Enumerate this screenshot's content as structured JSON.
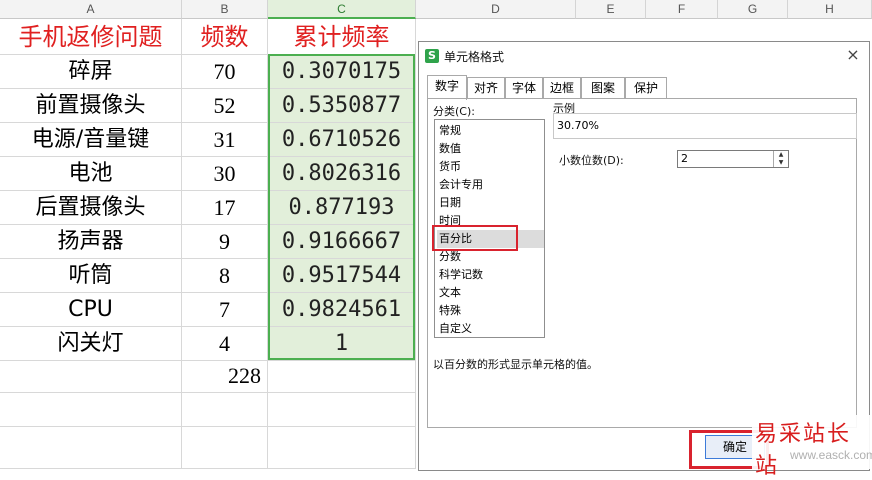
{
  "columns": [
    "A",
    "B",
    "C",
    "D",
    "E",
    "F",
    "G",
    "H"
  ],
  "headers": {
    "name": "手机返修问题",
    "count": "频数",
    "cum": "累计频率"
  },
  "rows": [
    {
      "name": "碎屏",
      "count": "70",
      "cum": "0.3070175"
    },
    {
      "name": "前置摄像头",
      "count": "52",
      "cum": "0.5350877"
    },
    {
      "name": "电源/音量键",
      "count": "31",
      "cum": "0.6710526"
    },
    {
      "name": "电池",
      "count": "30",
      "cum": "0.8026316"
    },
    {
      "name": "后置摄像头",
      "count": "17",
      "cum": "0.877193"
    },
    {
      "name": "扬声器",
      "count": "9",
      "cum": "0.9166667"
    },
    {
      "name": "听筒",
      "count": "8",
      "cum": "0.9517544"
    },
    {
      "name": "CPU",
      "count": "7",
      "cum": "0.9824561"
    },
    {
      "name": "闪关灯",
      "count": "4",
      "cum": "1"
    }
  ],
  "total": "228",
  "dialog": {
    "icon": "S",
    "title": "单元格格式",
    "close": "×",
    "tabs": [
      "数字",
      "对齐",
      "字体",
      "边框",
      "图案",
      "保护"
    ],
    "category_label": "分类(C):",
    "categories": [
      "常规",
      "数值",
      "货币",
      "会计专用",
      "日期",
      "时间",
      "百分比",
      "分数",
      "科学记数",
      "文本",
      "特殊",
      "自定义"
    ],
    "selected_category": "百分比",
    "sample_label": "示例",
    "sample_value": "30.70%",
    "decimals_label": "小数位数(D):",
    "decimals_value": "2",
    "description": "以百分数的形式显示单元格的值。",
    "ok": "确定"
  },
  "watermark": {
    "text": "易采站长站",
    "url": "www.easck.com"
  },
  "colors": {
    "header_red": "#e02020",
    "selection_green": "#4caf50",
    "fill_green": "#e2efda",
    "highlight_red": "#d9232e"
  }
}
